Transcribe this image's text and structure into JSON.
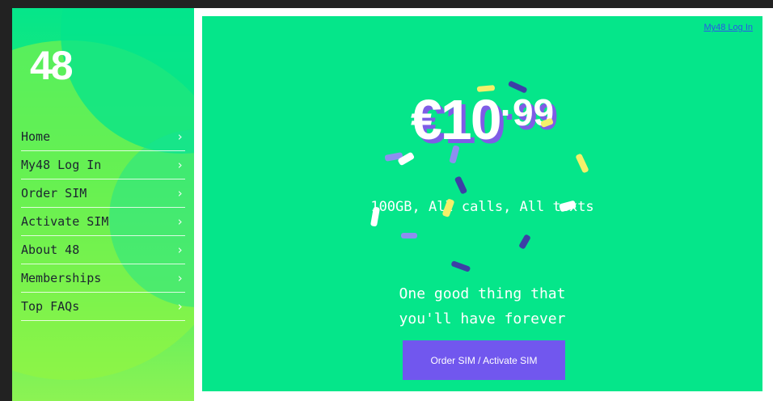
{
  "brand": {
    "logo_text": "48"
  },
  "sidebar": {
    "items": [
      {
        "label": "Home"
      },
      {
        "label": "My48 Log In"
      },
      {
        "label": "Order SIM"
      },
      {
        "label": "Activate SIM"
      },
      {
        "label": "About 48"
      },
      {
        "label": "Memberships"
      },
      {
        "label": "Top FAQs"
      }
    ],
    "chevron": "›"
  },
  "header": {
    "login_link": "My48 Log In"
  },
  "hero": {
    "price_main": "€10",
    "price_cents": "·99",
    "plan_text": "100GB, All calls, All texts",
    "tagline_line1": "One good thing that",
    "tagline_line2": "you'll have forever",
    "cta_label": "Order SIM / Activate SIM"
  },
  "colors": {
    "primary_green": "#05e68a",
    "lime": "#8cf353",
    "purple": "#7157ee",
    "confetti_yellow": "#f4f06a",
    "confetti_indigo": "#3d3fa6",
    "confetti_lavender": "#8f8ef0"
  }
}
